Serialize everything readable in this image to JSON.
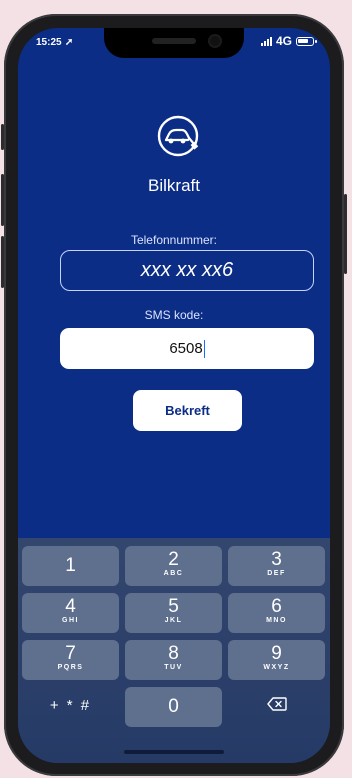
{
  "status_bar": {
    "time": "15:25",
    "network": "4G"
  },
  "app": {
    "name": "Bilkraft"
  },
  "form": {
    "phone_label": "Telefonnummer:",
    "phone_value": "xxx xx xx6",
    "sms_label": "SMS kode:",
    "sms_value": "6508",
    "confirm_label": "Bekreft"
  },
  "keypad": {
    "keys": [
      {
        "digit": "1",
        "letters": ""
      },
      {
        "digit": "2",
        "letters": "ABC"
      },
      {
        "digit": "3",
        "letters": "DEF"
      },
      {
        "digit": "4",
        "letters": "GHI"
      },
      {
        "digit": "5",
        "letters": "JKL"
      },
      {
        "digit": "6",
        "letters": "MNO"
      },
      {
        "digit": "7",
        "letters": "PQRS"
      },
      {
        "digit": "8",
        "letters": "TUV"
      },
      {
        "digit": "9",
        "letters": "WXYZ"
      },
      {
        "digit": "0",
        "letters": ""
      }
    ],
    "symbols_label": "+ * #"
  },
  "colors": {
    "background": "#0b2d86",
    "accent": "#ffffff",
    "keyboard": "#2e426c"
  }
}
